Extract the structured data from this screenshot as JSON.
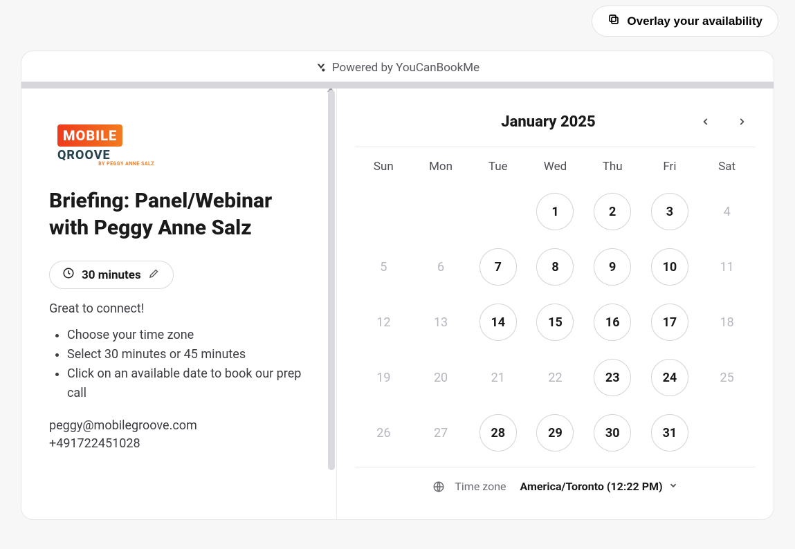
{
  "overlay_button": "Overlay your availability",
  "powered_by": "Powered by YouCanBookMe",
  "brand": {
    "mobile": "MOBILE",
    "groove": "QROOVE",
    "byline": "BY PEGGY ANNE SALZ"
  },
  "title": "Briefing: Panel/Webinar with Peggy Anne Salz",
  "duration": "30 minutes",
  "intro": "Great to connect!",
  "steps": [
    "Choose your time zone",
    "Select 30 minutes or 45 minutes",
    "Click on an available date to book our prep call"
  ],
  "contact": {
    "email": "peggy@mobilegroove.com",
    "phone": "+491722451028"
  },
  "calendar": {
    "month_label": "January 2025",
    "weekdays": [
      "Sun",
      "Mon",
      "Tue",
      "Wed",
      "Thu",
      "Fri",
      "Sat"
    ],
    "days": [
      {
        "n": "",
        "avail": false
      },
      {
        "n": "",
        "avail": false
      },
      {
        "n": "",
        "avail": false
      },
      {
        "n": "1",
        "avail": true
      },
      {
        "n": "2",
        "avail": true
      },
      {
        "n": "3",
        "avail": true
      },
      {
        "n": "4",
        "avail": false
      },
      {
        "n": "5",
        "avail": false
      },
      {
        "n": "6",
        "avail": false
      },
      {
        "n": "7",
        "avail": true
      },
      {
        "n": "8",
        "avail": true
      },
      {
        "n": "9",
        "avail": true
      },
      {
        "n": "10",
        "avail": true
      },
      {
        "n": "11",
        "avail": false
      },
      {
        "n": "12",
        "avail": false
      },
      {
        "n": "13",
        "avail": false
      },
      {
        "n": "14",
        "avail": true
      },
      {
        "n": "15",
        "avail": true
      },
      {
        "n": "16",
        "avail": true
      },
      {
        "n": "17",
        "avail": true
      },
      {
        "n": "18",
        "avail": false
      },
      {
        "n": "19",
        "avail": false
      },
      {
        "n": "20",
        "avail": false
      },
      {
        "n": "21",
        "avail": false
      },
      {
        "n": "22",
        "avail": false
      },
      {
        "n": "23",
        "avail": true
      },
      {
        "n": "24",
        "avail": true
      },
      {
        "n": "25",
        "avail": false
      },
      {
        "n": "26",
        "avail": false
      },
      {
        "n": "27",
        "avail": false
      },
      {
        "n": "28",
        "avail": true
      },
      {
        "n": "29",
        "avail": true
      },
      {
        "n": "30",
        "avail": true
      },
      {
        "n": "31",
        "avail": true
      },
      {
        "n": "",
        "avail": false
      }
    ]
  },
  "timezone": {
    "label": "Time zone",
    "value": "America/Toronto (12:22 PM)"
  }
}
